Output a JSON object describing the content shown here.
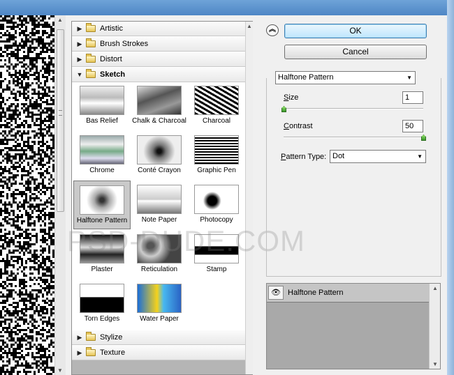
{
  "categories_top": [
    {
      "label": "Artistic",
      "expanded": false
    },
    {
      "label": "Brush Strokes",
      "expanded": false
    },
    {
      "label": "Distort",
      "expanded": false
    },
    {
      "label": "Sketch",
      "expanded": true
    }
  ],
  "categories_bottom": [
    {
      "label": "Stylize",
      "expanded": false
    },
    {
      "label": "Texture",
      "expanded": false
    }
  ],
  "sketch_filters": [
    {
      "label": "Bas Relief"
    },
    {
      "label": "Chalk & Charcoal"
    },
    {
      "label": "Charcoal"
    },
    {
      "label": "Chrome"
    },
    {
      "label": "Conté Crayon"
    },
    {
      "label": "Graphic Pen"
    },
    {
      "label": "Halftone Pattern",
      "selected": true
    },
    {
      "label": "Note Paper"
    },
    {
      "label": "Photocopy"
    },
    {
      "label": "Plaster"
    },
    {
      "label": "Reticulation"
    },
    {
      "label": "Stamp"
    },
    {
      "label": "Torn Edges"
    },
    {
      "label": "Water Paper"
    }
  ],
  "buttons": {
    "ok": "OK",
    "cancel": "Cancel"
  },
  "settings": {
    "filter_select": "Halftone Pattern",
    "size": {
      "label": "Size",
      "value": "1",
      "fraction": 0.0
    },
    "contrast": {
      "label": "Contrast",
      "value": "50",
      "fraction": 1.0
    },
    "pattern_type": {
      "label": "Pattern Type:",
      "value": "Dot"
    }
  },
  "layers": {
    "items": [
      {
        "label": "Halftone Pattern",
        "visible": true
      }
    ]
  },
  "watermark": "PSD-DUDE.COM",
  "icons": {
    "collapse": "collapse-up-icon",
    "eye": "eye-icon",
    "folder": "folder-icon",
    "expand_triangle": "triangle-right-icon"
  }
}
